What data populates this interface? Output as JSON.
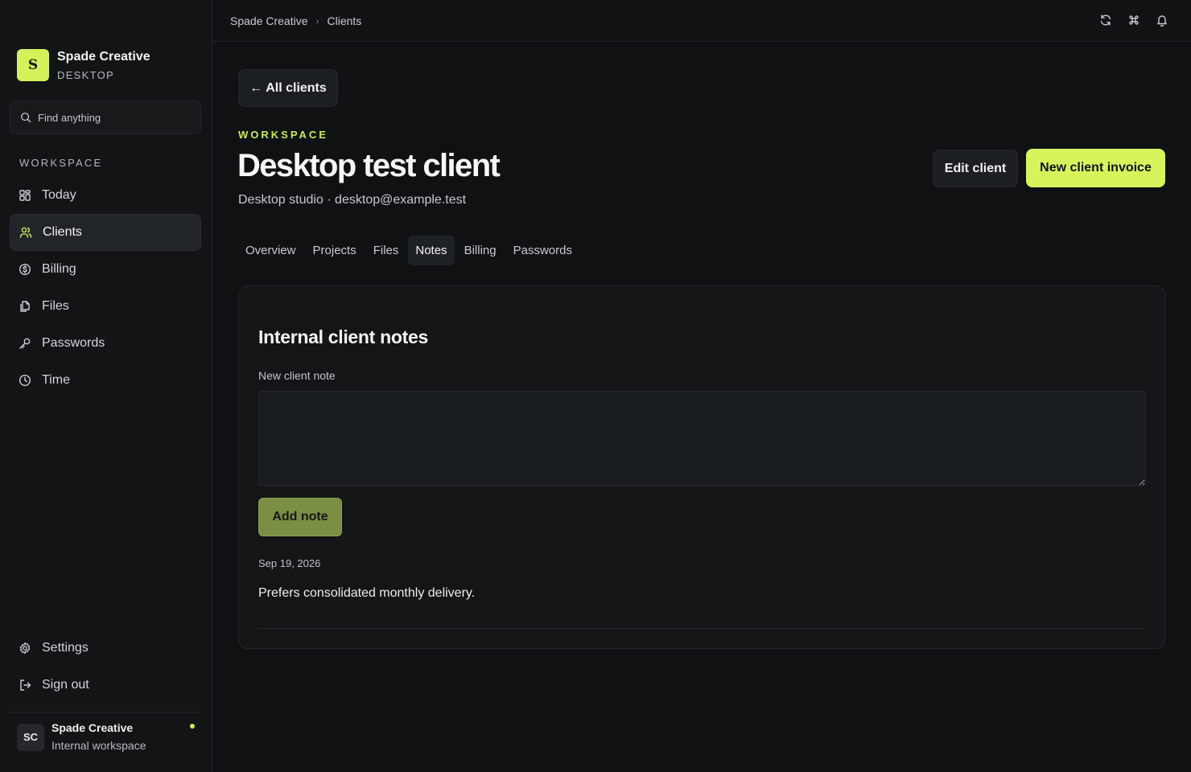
{
  "brand": {
    "logo_letter": "S",
    "name": "Spade Creative",
    "subtitle": "DESKTOP"
  },
  "search": {
    "placeholder": "Find anything",
    "icon": "search-icon"
  },
  "sidebar": {
    "section_label": "WORKSPACE",
    "items": [
      {
        "label": "Today",
        "icon": "grid-icon",
        "active": false
      },
      {
        "label": "Clients",
        "icon": "users-icon",
        "active": true
      },
      {
        "label": "Billing",
        "icon": "dollar-circle-icon",
        "active": false
      },
      {
        "label": "Files",
        "icon": "files-icon",
        "active": false
      },
      {
        "label": "Passwords",
        "icon": "key-icon",
        "active": false
      },
      {
        "label": "Time",
        "icon": "clock-icon",
        "active": false
      }
    ],
    "bottom_items": [
      {
        "label": "Settings",
        "icon": "gear-icon"
      },
      {
        "label": "Sign out",
        "icon": "sign-out-icon"
      }
    ]
  },
  "user": {
    "initials": "SC",
    "name": "Spade Creative",
    "subtitle": "Internal workspace",
    "status": "online"
  },
  "topbar": {
    "breadcrumb": [
      "Spade Creative",
      "Clients"
    ],
    "icons": [
      "refresh-icon",
      "command-icon",
      "bell-icon"
    ]
  },
  "header": {
    "back_label": "All clients",
    "eyebrow": "WORKSPACE",
    "title": "Desktop test client",
    "subtitle": "Desktop studio · desktop@example.test",
    "edit_label": "Edit client",
    "invoice_label": "New client invoice"
  },
  "tabs": [
    {
      "label": "Overview",
      "active": false
    },
    {
      "label": "Projects",
      "active": false
    },
    {
      "label": "Files",
      "active": false
    },
    {
      "label": "Notes",
      "active": true
    },
    {
      "label": "Billing",
      "active": false
    },
    {
      "label": "Passwords",
      "active": false
    }
  ],
  "notes_card": {
    "title": "Internal client notes",
    "field_label": "New client note",
    "input_value": "",
    "add_label": "Add note",
    "notes": [
      {
        "date": "Sep 19, 2026",
        "body": "Prefers consolidated monthly delivery."
      }
    ]
  },
  "colors": {
    "accent": "#d6f55d",
    "background": "#0f1113",
    "sidebar": "#121416"
  }
}
